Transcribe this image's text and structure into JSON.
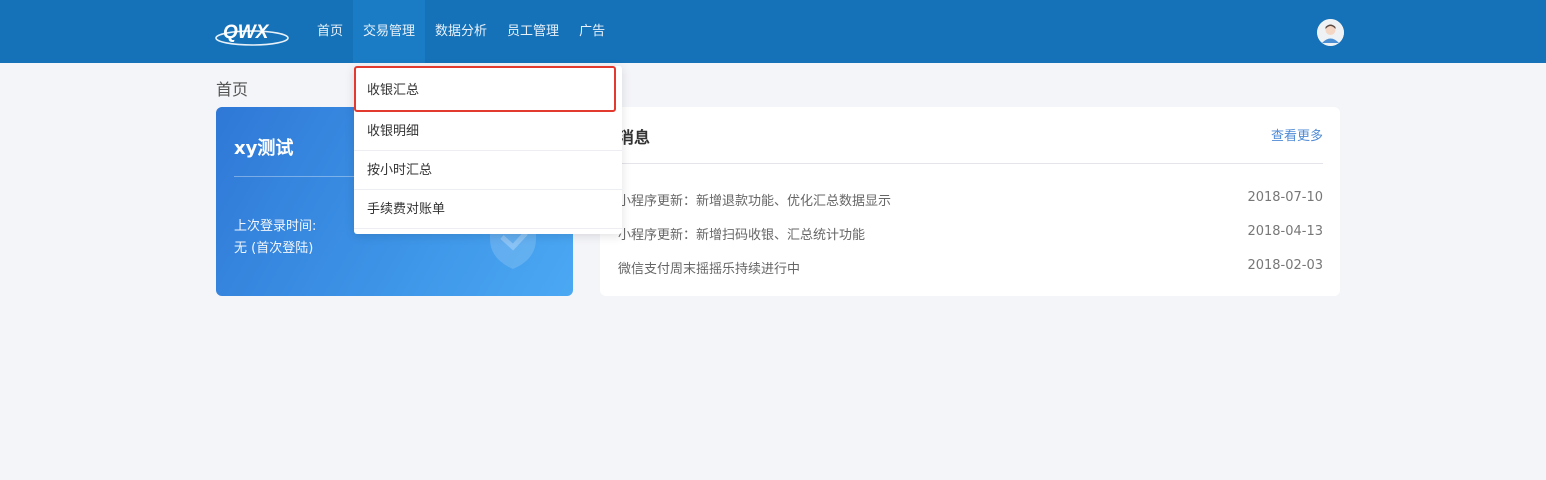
{
  "header": {
    "logo_text": "QWX",
    "nav": [
      "首页",
      "交易管理",
      "数据分析",
      "员工管理",
      "广告"
    ],
    "active_nav": "交易管理"
  },
  "dropdown": {
    "items": [
      "收银汇总",
      "收银明细",
      "按小时汇总",
      "手续费对账单"
    ],
    "highlighted": "收银汇总"
  },
  "page": {
    "title": "首页"
  },
  "user_card": {
    "name": "xy测试",
    "last_login_label": "上次登录时间:",
    "last_login_value": "无 (首次登陆)"
  },
  "messages": {
    "title": "消息",
    "more_label": "查看更多",
    "items": [
      {
        "text": "小程序更新：新增退款功能、优化汇总数据显示",
        "date": "2018-07-10"
      },
      {
        "text": "小程序更新：新增扫码收银、汇总统计功能",
        "date": "2018-04-13"
      },
      {
        "text": "微信支付周末摇摇乐持续进行中",
        "date": "2018-02-03"
      }
    ]
  },
  "colors": {
    "header_bg": "#1572b8",
    "highlight_border": "#e23a2e",
    "link": "#4f8bd6"
  }
}
